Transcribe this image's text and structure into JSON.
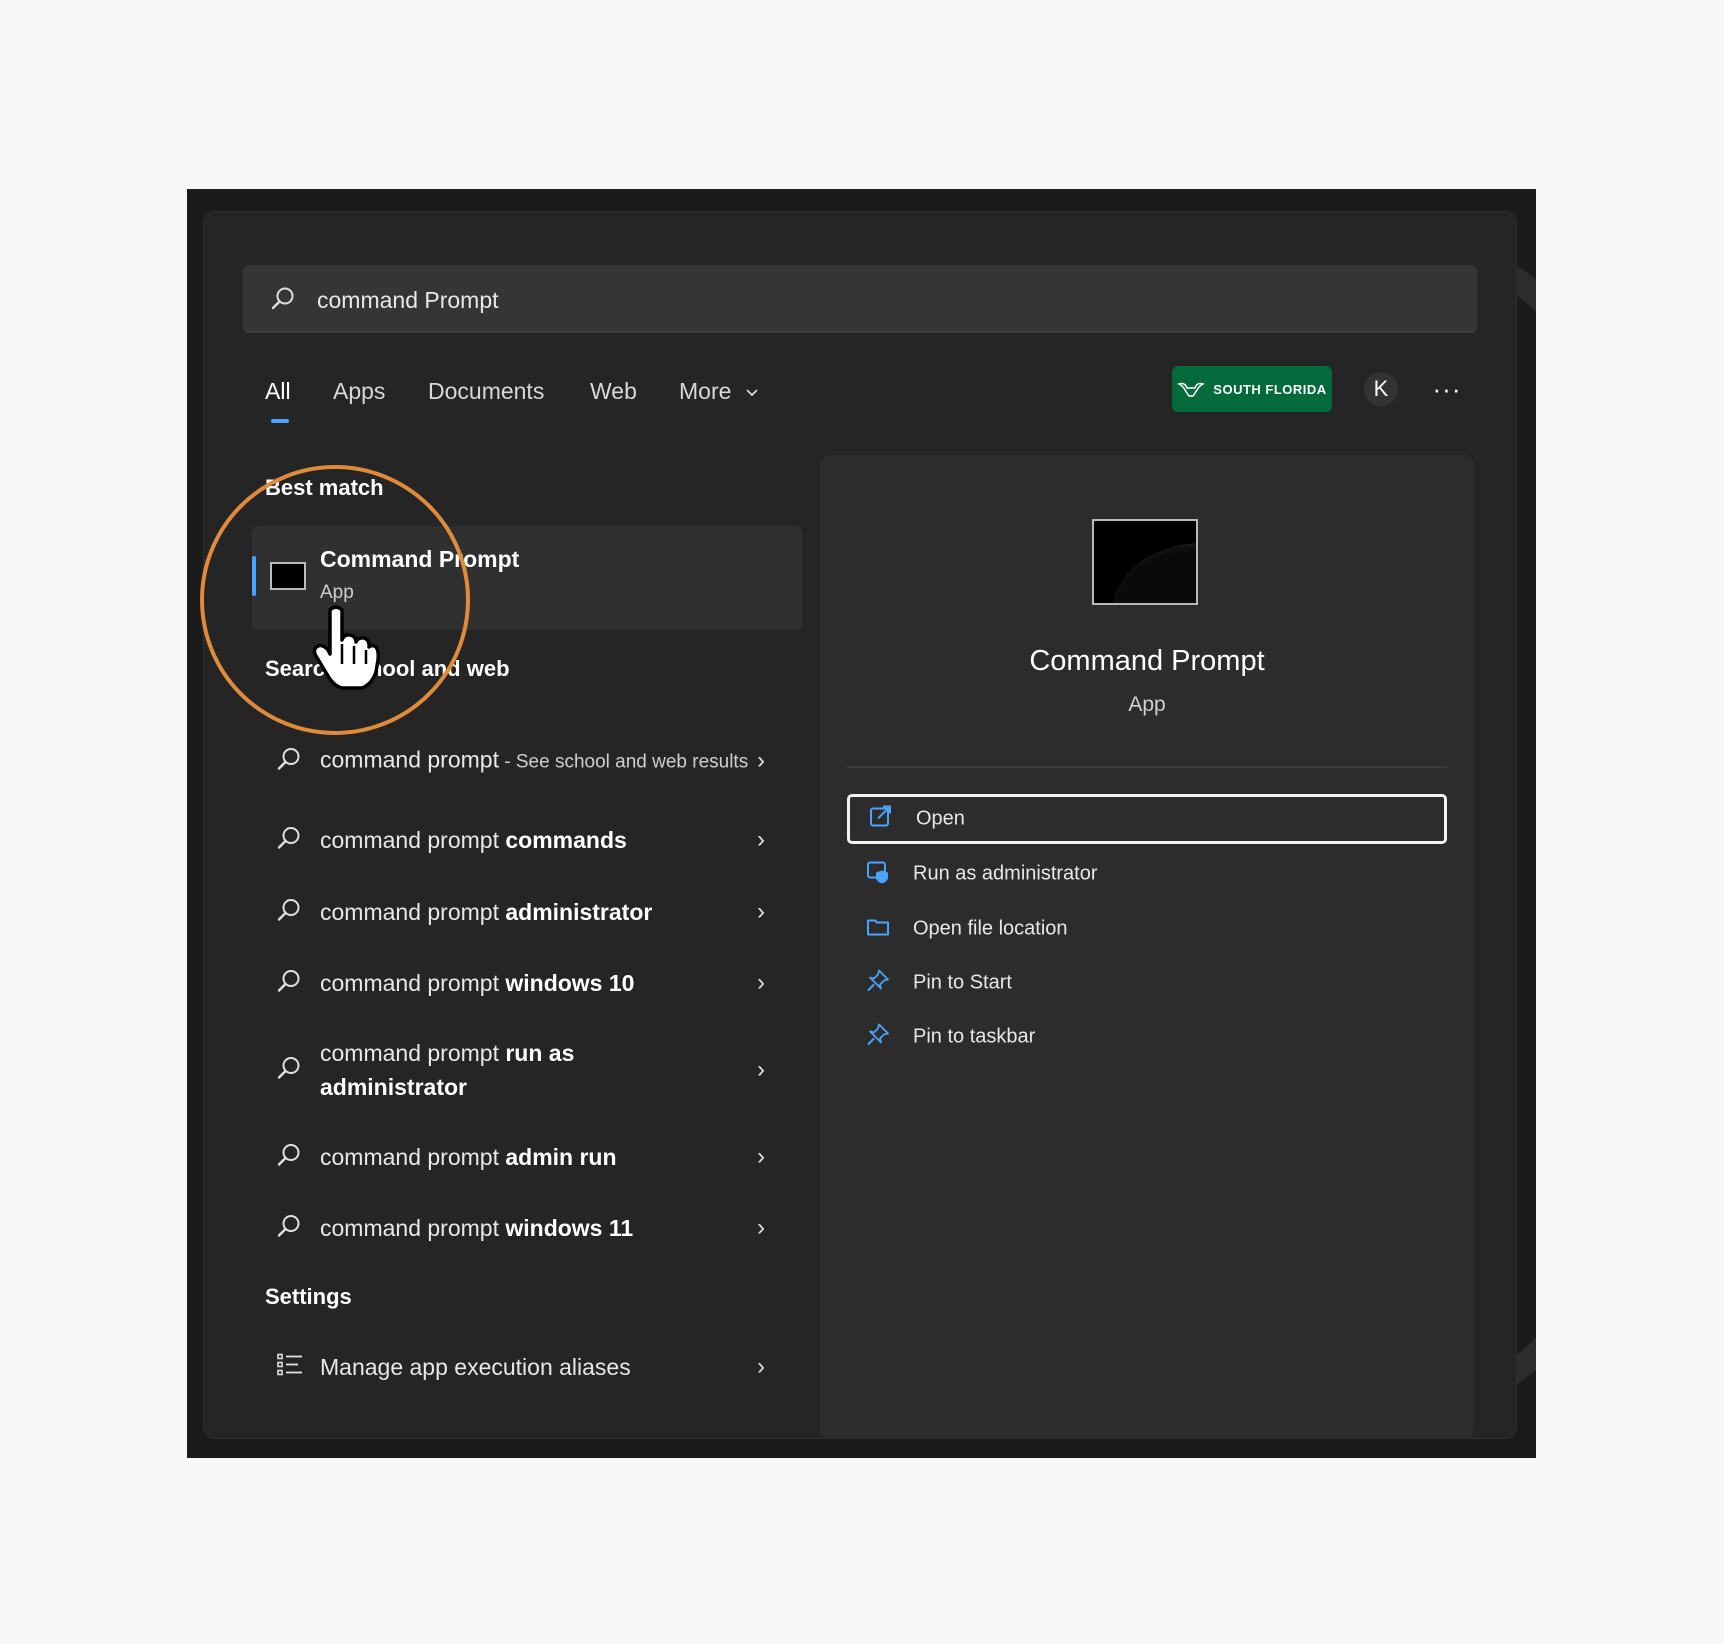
{
  "search": {
    "query": "command Prompt"
  },
  "tabs": [
    {
      "label": "All",
      "active": true
    },
    {
      "label": "Apps"
    },
    {
      "label": "Documents"
    },
    {
      "label": "Web"
    },
    {
      "label": "More"
    }
  ],
  "header": {
    "org_badge_label": "SOUTH FLORIDA",
    "avatar_initial": "K",
    "more_label": "···"
  },
  "best_match": {
    "heading": "Best match",
    "name": "Command Prompt",
    "type": "App"
  },
  "school_web": {
    "heading": "Search school and web",
    "items": [
      {
        "prefix": "command prompt",
        "bold": "",
        "suffix": " - See school and web results"
      },
      {
        "prefix": "command prompt ",
        "bold": "commands",
        "suffix": ""
      },
      {
        "prefix": "command prompt ",
        "bold": "administrator",
        "suffix": ""
      },
      {
        "prefix": "command prompt ",
        "bold": "windows 10",
        "suffix": ""
      },
      {
        "prefix": "command prompt ",
        "bold": "run as administrator",
        "suffix": ""
      },
      {
        "prefix": "command prompt ",
        "bold": "admin run",
        "suffix": ""
      },
      {
        "prefix": "command prompt ",
        "bold": "windows 11",
        "suffix": ""
      }
    ]
  },
  "settings": {
    "heading": "Settings",
    "items": [
      {
        "label": "Manage app execution aliases"
      }
    ]
  },
  "preview": {
    "title": "Command Prompt",
    "subtitle": "App",
    "actions": [
      {
        "label": "Open",
        "icon": "open-icon"
      },
      {
        "label": "Run as administrator",
        "icon": "shield-icon"
      },
      {
        "label": "Open file location",
        "icon": "folder-icon"
      },
      {
        "label": "Pin to Start",
        "icon": "pin-icon"
      },
      {
        "label": "Pin to taskbar",
        "icon": "pin-icon"
      }
    ]
  },
  "colors": {
    "accent": "#4aa3ff",
    "annotation": "#e08a3c",
    "badge": "#036a3c"
  }
}
